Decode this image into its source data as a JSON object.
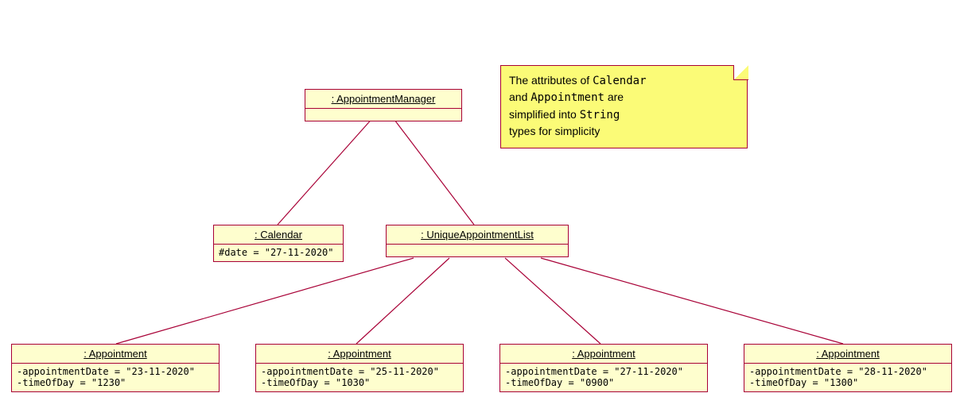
{
  "note": {
    "line1_pre": "The attributes of ",
    "line1_code": "Calendar",
    "line2_pre": "and ",
    "line2_code": "Appointment",
    "line2_post": " are",
    "line3_pre": "simplified into ",
    "line3_code": "String",
    "line4": "types for simplicity"
  },
  "objects": {
    "manager": {
      "title": ": AppointmentManager"
    },
    "calendar": {
      "title": ": Calendar",
      "attr1": "#date = \"27-11-2020\""
    },
    "list": {
      "title": ": UniqueAppointmentList"
    },
    "appt1": {
      "title": ": Appointment",
      "attr1": "-appointmentDate = \"23-11-2020\"",
      "attr2": "-timeOfDay = \"1230\""
    },
    "appt2": {
      "title": ": Appointment",
      "attr1": "-appointmentDate = \"25-11-2020\"",
      "attr2": "-timeOfDay = \"1030\""
    },
    "appt3": {
      "title": ": Appointment",
      "attr1": "-appointmentDate = \"27-11-2020\"",
      "attr2": "-timeOfDay = \"0900\""
    },
    "appt4": {
      "title": ": Appointment",
      "attr1": "-appointmentDate = \"28-11-2020\"",
      "attr2": "-timeOfDay = \"1300\""
    }
  }
}
